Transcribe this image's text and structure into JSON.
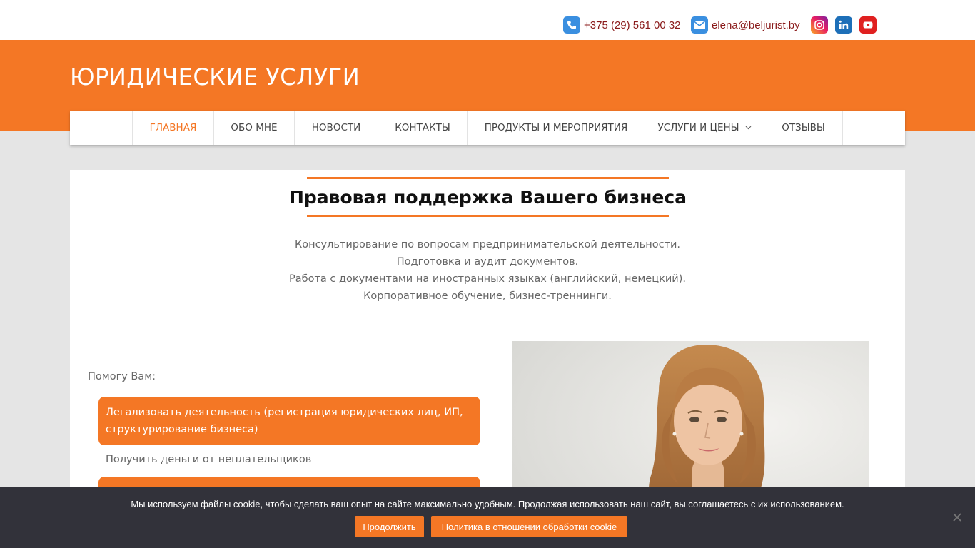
{
  "topbar": {
    "phone": "+375 (29) 561 00 32",
    "email": "elena@beljurist.by",
    "social": [
      {
        "icon": "instagram-icon",
        "color": "#d6249f"
      },
      {
        "icon": "linkedin-icon",
        "color": "#1d6fb8"
      },
      {
        "icon": "youtube-icon",
        "color": "#e02020"
      }
    ]
  },
  "site": {
    "title": "ЮРИДИЧЕСКИЕ УСЛУГИ",
    "accent_color": "#f47725"
  },
  "nav": {
    "items": [
      {
        "label": "ГЛАВНАЯ",
        "active": true
      },
      {
        "label": "ОБО МНЕ"
      },
      {
        "label": "НОВОСТИ"
      },
      {
        "label": "КОНТАКТЫ"
      },
      {
        "label": "ПРОДУКТЫ И МЕРОПРИЯТИЯ"
      },
      {
        "label": "УСЛУГИ И ЦЕНЫ",
        "has_dropdown": true
      },
      {
        "label": "ОТЗЫВЫ"
      }
    ]
  },
  "main": {
    "heading": "Правовая поддержка Вашего бизнеса",
    "intro": [
      "Консультирование по вопросам предпринимательской деятельности.",
      "Подготовка и аудит документов.",
      "Работа с документами на иностранных языках (английский, немецкий).",
      "Корпоративное обучение, бизнес-треннинги."
    ],
    "help_label": "Помогу Вам:",
    "services": [
      "Легализовать деятельность (регистрация юридических лиц, ИП, структурирование бизнеса)",
      "Получить деньги от неплательщиков"
    ]
  },
  "cookie": {
    "text": "Мы используем файлы cookie, чтобы сделать ваш опыт на сайте максимально удобным. Продолжая использовать наш сайт, вы соглашаетесь с их использованием.",
    "accept_label": "Продолжить",
    "policy_label": "Политика в отношении обработки cookie"
  }
}
